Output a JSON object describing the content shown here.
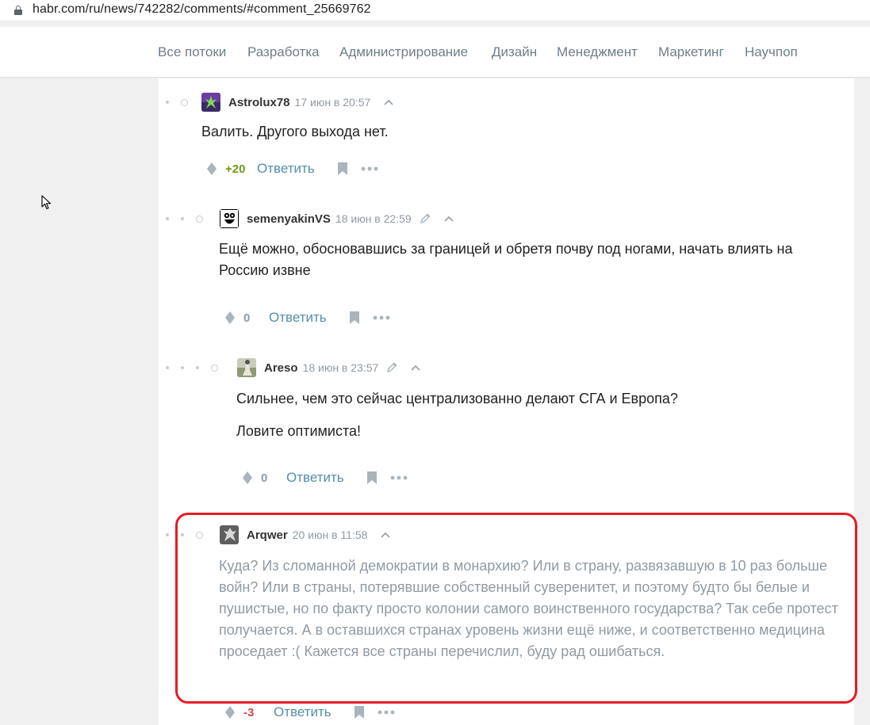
{
  "browser": {
    "url": "habr.com/ru/news/742282/comments/#comment_25669762"
  },
  "nav": {
    "items": [
      "Все потоки",
      "Разработка",
      "Администрирование",
      "Дизайн",
      "Менеджмент",
      "Маркетинг",
      "Научпоп"
    ]
  },
  "comments": [
    {
      "user": "Astrolux78",
      "date": "17 июн в 20:57",
      "edited": false,
      "text": [
        "Валить. Другого выхода нет."
      ],
      "score": "+20",
      "reply": "Ответить",
      "avatar_color": "#5a3b8c"
    },
    {
      "user": "semenyakinVS",
      "date": "18 июн в 22:59",
      "edited": true,
      "text": [
        "Ещё можно, обосновавшись за границей и обретя почву под ногами, начать влиять на Россию извне"
      ],
      "score": "0",
      "reply": "Ответить",
      "avatar_color": "#000000"
    },
    {
      "user": "Areso",
      "date": "18 июн в 23:57",
      "edited": true,
      "text": [
        "Сильнее, чем это сейчас централизованно делают СГА и Европа?",
        "Ловите оптимиста!"
      ],
      "score": "0",
      "reply": "Ответить",
      "avatar_color": "#9aa58a"
    },
    {
      "user": "Arqwer",
      "date": "20 июн в 11:58",
      "edited": false,
      "text": [
        "Куда? Из сломанной демократии в монархию? Или в страну, развязавшую в 10 раз больше войн? Или в страны, потерявшие собственный суверенитет, и поэтому будто бы белые и пушистые, но по факту просто колонии самого воинственного государства? Так себе протест получается. А в оставшихся странах уровень жизни ещё ниже, и соответственно медицина проседает :( Кажется все страны перечислил, буду рад ошибаться."
      ],
      "score": "-3",
      "reply": "Ответить",
      "avatar_color": "#6b6b6b"
    }
  ],
  "colors": {
    "highlight": "#e51c23",
    "positive": "#6c9b14",
    "negative": "#d04a4a",
    "link": "#548eaa"
  }
}
